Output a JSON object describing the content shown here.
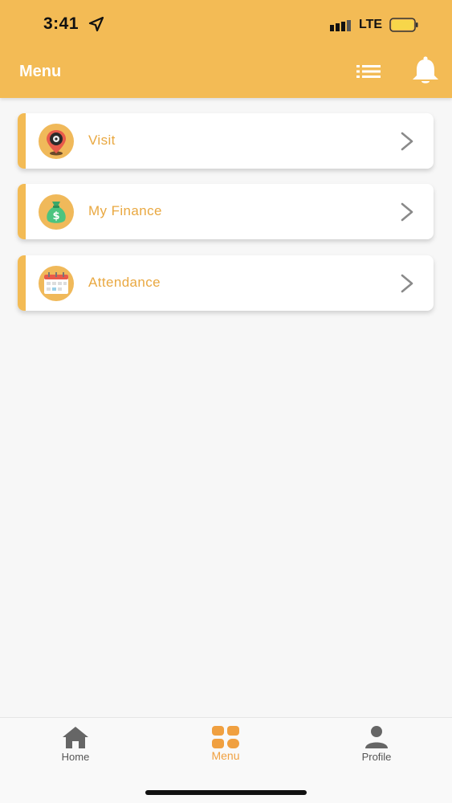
{
  "status_bar": {
    "time": "3:41",
    "network": "LTE"
  },
  "header": {
    "title": "Menu"
  },
  "menu_items": [
    {
      "label": "Visit",
      "icon": "location-pin-icon"
    },
    {
      "label": "My Finance",
      "icon": "money-bag-icon"
    },
    {
      "label": "Attendance",
      "icon": "calendar-icon"
    }
  ],
  "bottom_nav": {
    "home": "Home",
    "menu": "Menu",
    "profile": "Profile"
  },
  "colors": {
    "accent": "#f3bb55",
    "label": "#e9a841",
    "active_nav": "#f0a040"
  }
}
